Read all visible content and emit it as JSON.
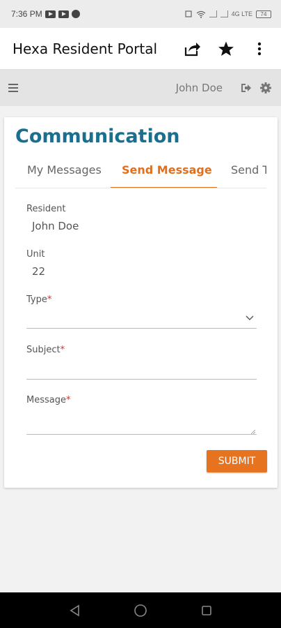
{
  "status_bar": {
    "time": "7:36 PM",
    "right_text": "4G LTE",
    "battery": "74"
  },
  "app_bar": {
    "title": "Hexa Resident Portal",
    "icons": [
      "share-icon",
      "star-icon",
      "more-vert-icon"
    ]
  },
  "portal_header": {
    "user_name": "John Doe",
    "icons": [
      "menu-icon",
      "logout-icon",
      "gear-icon"
    ]
  },
  "page": {
    "title": "Communication",
    "tabs": [
      {
        "label": "My Messages",
        "active": false
      },
      {
        "label": "Send Message",
        "active": true
      },
      {
        "label": "Send Te",
        "active": false
      }
    ]
  },
  "form": {
    "resident_label": "Resident",
    "resident_value": "John Doe",
    "unit_label": "Unit",
    "unit_value": "22",
    "type_label": "Type",
    "type_value": "",
    "subject_label": "Subject",
    "subject_value": "",
    "message_label": "Message",
    "message_value": "",
    "required_marker": "*",
    "submit_label": "SUBMIT"
  },
  "colors": {
    "accent": "#e5731f",
    "title": "#1a6e8e",
    "required": "#d32f2f"
  }
}
